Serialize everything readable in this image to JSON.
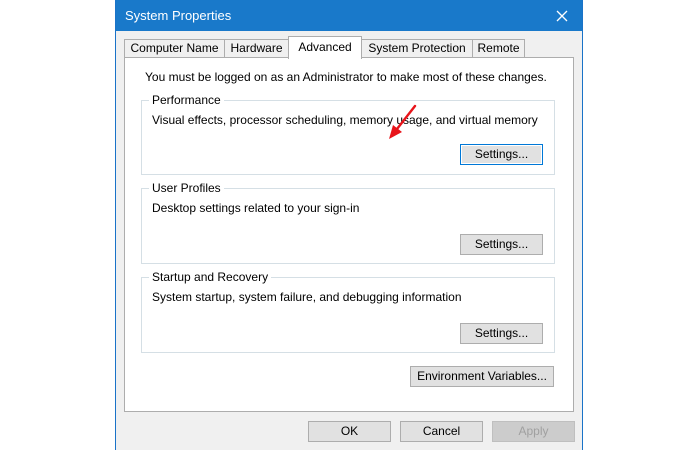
{
  "window": {
    "title": "System Properties",
    "accent_color": "#1979ca",
    "close_icon": "close-icon"
  },
  "tabs": [
    {
      "label": "Computer Name",
      "active": false
    },
    {
      "label": "Hardware",
      "active": false
    },
    {
      "label": "Advanced",
      "active": true
    },
    {
      "label": "System Protection",
      "active": false
    },
    {
      "label": "Remote",
      "active": false
    }
  ],
  "advanced": {
    "admin_note": "You must be logged on as an Administrator to make most of these changes.",
    "performance": {
      "title": "Performance",
      "description": "Visual effects, processor scheduling, memory usage, and virtual memory",
      "button": "Settings..."
    },
    "user_profiles": {
      "title": "User Profiles",
      "description": "Desktop settings related to your sign-in",
      "button": "Settings..."
    },
    "startup_recovery": {
      "title": "Startup and Recovery",
      "description": "System startup, system failure, and debugging information",
      "button": "Settings..."
    },
    "env_button": "Environment Variables..."
  },
  "footer": {
    "ok": "OK",
    "cancel": "Cancel",
    "apply": "Apply"
  },
  "annotation": {
    "arrow_color": "#e8141a",
    "icon": "red-arrow-icon"
  }
}
